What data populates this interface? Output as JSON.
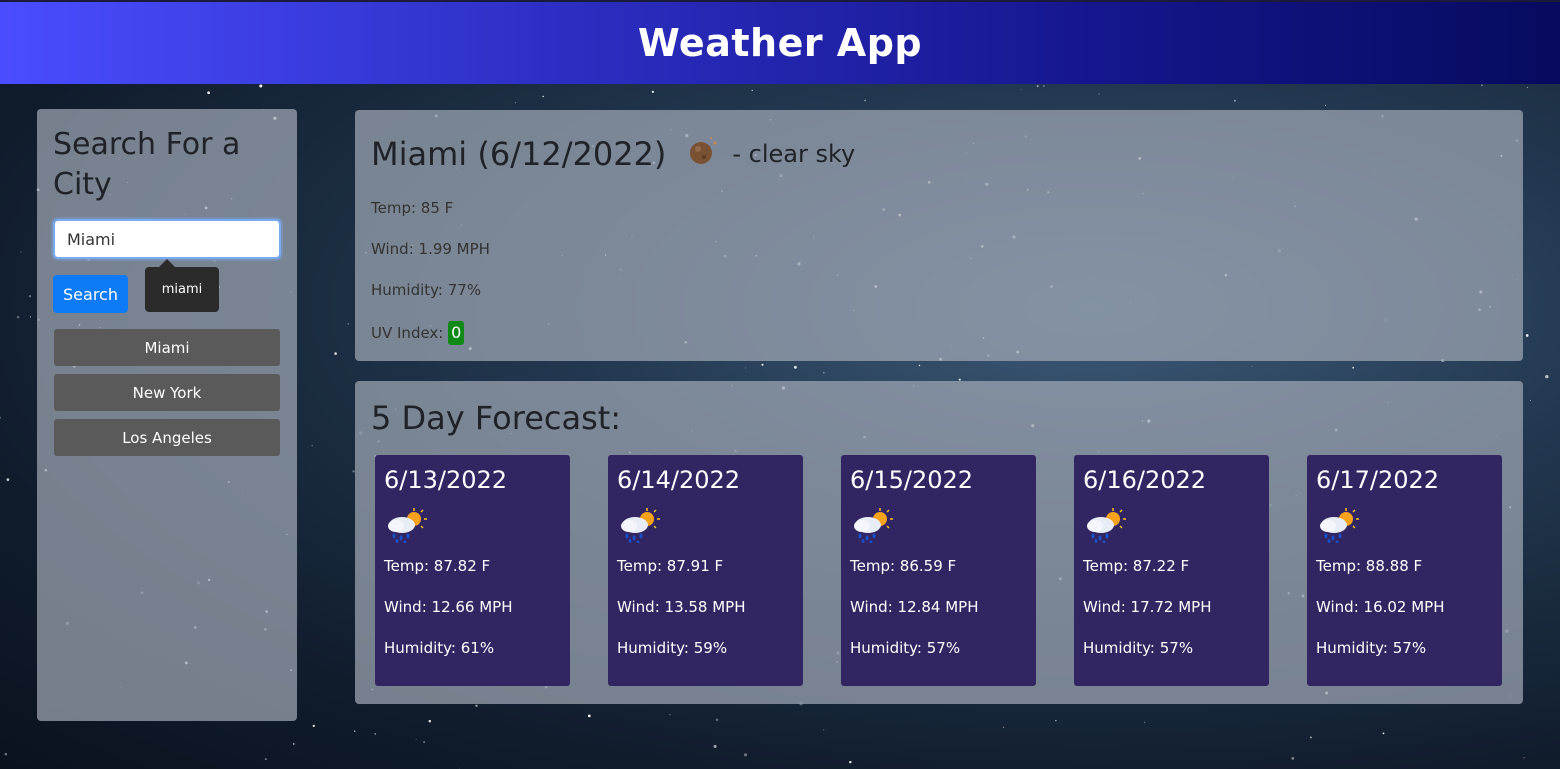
{
  "app": {
    "title": "Weather App"
  },
  "sidebar": {
    "heading": "Search For a City",
    "search": {
      "value": "Miami",
      "placeholder": ""
    },
    "search_button": "Search",
    "tooltip": "miami",
    "history": [
      "Miami",
      "New York",
      "Los Angeles"
    ]
  },
  "current": {
    "title": "Miami (6/12/2022)",
    "condition": "- clear sky",
    "icon": "clear-sky-night-icon",
    "temp": "Temp: 85 F",
    "wind": "Wind: 1.99 MPH",
    "humidity": "Humidity: 77%",
    "uv_label": "UV Index:",
    "uv_value": "0",
    "uv_color": "#0f8a17"
  },
  "forecast": {
    "heading": "5 Day Forecast:",
    "days": [
      {
        "date": "6/13/2022",
        "icon": "rain-sun-icon",
        "temp": "Temp: 87.82 F",
        "wind": "Wind: 12.66 MPH",
        "humidity": "Humidity: 61%"
      },
      {
        "date": "6/14/2022",
        "icon": "rain-sun-icon",
        "temp": "Temp: 87.91 F",
        "wind": "Wind: 13.58 MPH",
        "humidity": "Humidity: 59%"
      },
      {
        "date": "6/15/2022",
        "icon": "rain-sun-icon",
        "temp": "Temp: 86.59 F",
        "wind": "Wind: 12.84 MPH",
        "humidity": "Humidity: 57%"
      },
      {
        "date": "6/16/2022",
        "icon": "rain-sun-icon",
        "temp": "Temp: 87.22 F",
        "wind": "Wind: 17.72 MPH",
        "humidity": "Humidity: 57%"
      },
      {
        "date": "6/17/2022",
        "icon": "rain-sun-icon",
        "temp": "Temp: 88.88 F",
        "wind": "Wind: 16.02 MPH",
        "humidity": "Humidity: 57%"
      }
    ]
  },
  "colors": {
    "header_start": "#4a4dff",
    "header_end": "#070a5e",
    "card_bg": "#322662",
    "search_button": "#0d7bf5",
    "history_button": "#5a5a5a"
  }
}
